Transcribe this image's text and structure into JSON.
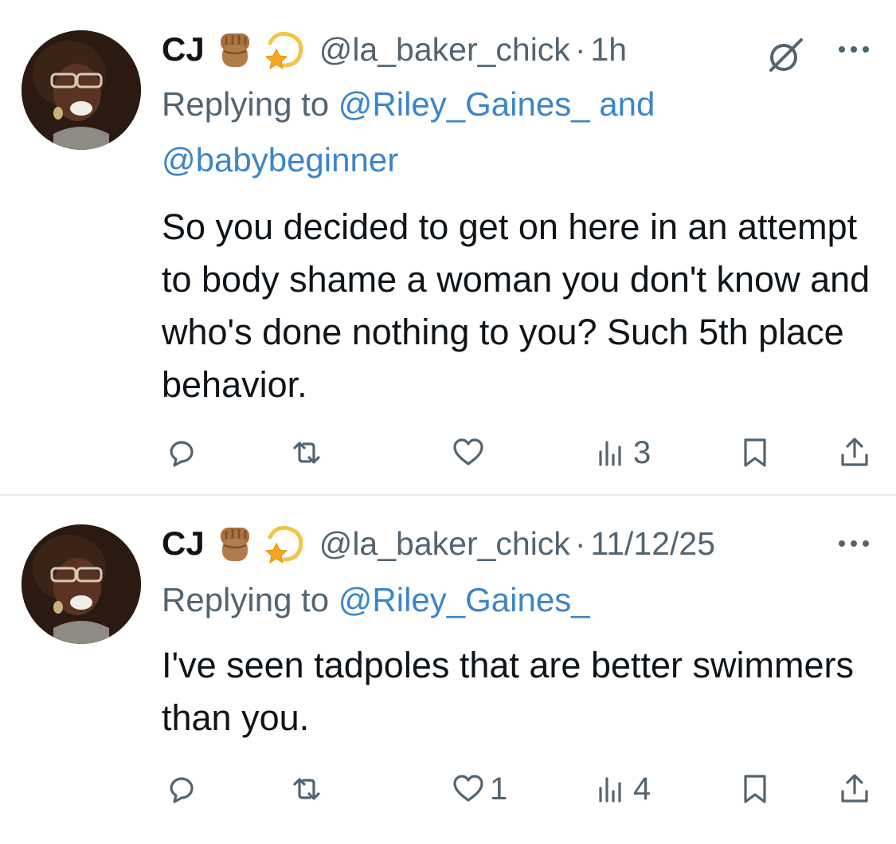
{
  "tweets": [
    {
      "name": "CJ",
      "emoji": [
        "raised-fist-medium-skin-emoji",
        "dizzy-emoji"
      ],
      "handle": "@la_baker_chick",
      "dot": "·",
      "time": "1h",
      "replying_prefix": "Replying to ",
      "reply_mention_1": "@Riley_Gaines_",
      "reply_and": " and",
      "reply_mention_2": "@babybeginner",
      "text": "So you decided to get on here in an attempt to body shame a woman you don't know and who's done nothing to you? Such 5th place behavior.",
      "actions": {
        "reply_count": "",
        "retweet_count": "",
        "like_count": "",
        "views_count": "3"
      }
    },
    {
      "name": "CJ",
      "emoji": [
        "raised-fist-medium-skin-emoji",
        "dizzy-emoji"
      ],
      "handle": "@la_baker_chick",
      "dot": "·",
      "time": "11/12/25",
      "replying_prefix": "Replying to ",
      "reply_mention_1": "@Riley_Gaines_",
      "text": "I've seen tadpoles that are better swimmers than you.",
      "actions": {
        "reply_count": "",
        "retweet_count": "",
        "like_count": "1",
        "views_count": "4"
      }
    }
  ],
  "colors": {
    "text": "#0f1419",
    "muted": "#536471",
    "link": "#3b85c8",
    "divider": "#e6e9ec"
  }
}
